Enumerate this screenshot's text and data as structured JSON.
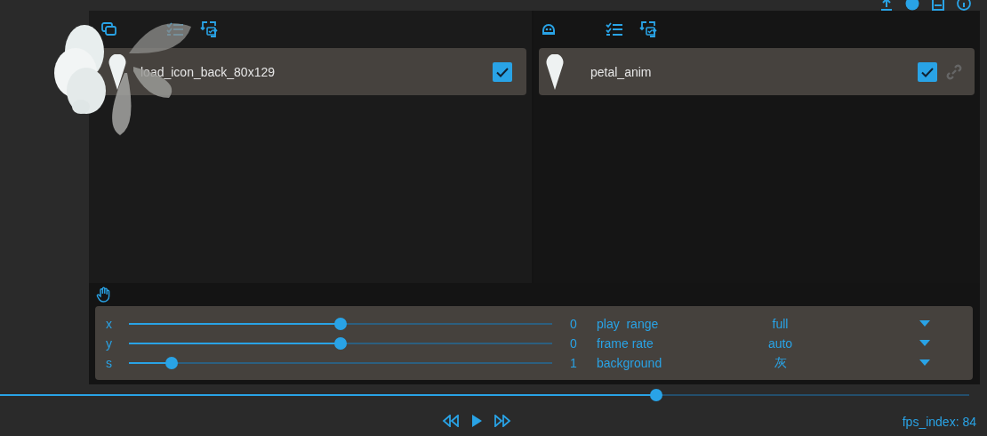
{
  "layers_panel": {
    "items": [
      {
        "name": "load_icon_back_80x129",
        "checked": true
      }
    ]
  },
  "animations_panel": {
    "items": [
      {
        "name": "petal_anim",
        "checked": true
      }
    ]
  },
  "transform": {
    "sliders": [
      {
        "label": "x",
        "level": 0.5,
        "value": "0"
      },
      {
        "label": "y",
        "level": 0.5,
        "value": "0"
      },
      {
        "label": "s",
        "level": 0.1,
        "value": "1"
      }
    ]
  },
  "options": [
    {
      "label": "play  range",
      "value": "full"
    },
    {
      "label": "frame rate",
      "value": "auto"
    },
    {
      "label": "background",
      "value": "灰"
    }
  ],
  "timeline": {
    "level": 0.677
  },
  "fps_label": "fps_index: 84"
}
